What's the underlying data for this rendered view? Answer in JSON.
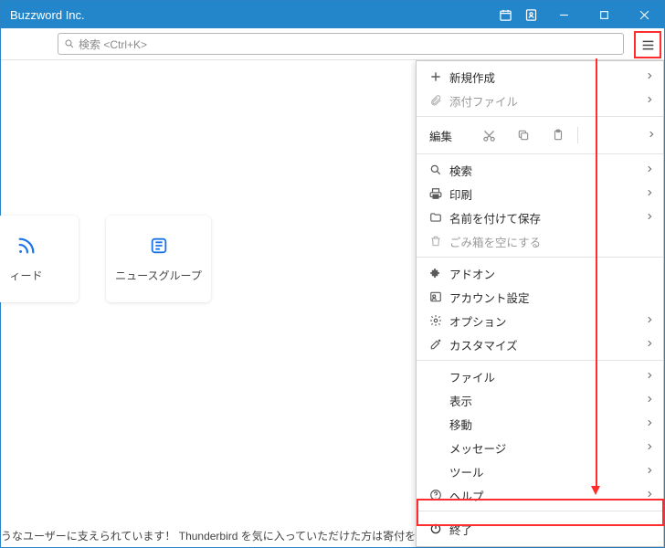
{
  "titlebar": {
    "title": "Buzzword Inc."
  },
  "search": {
    "placeholder": "検索 <Ctrl+K>"
  },
  "cards": {
    "feed": {
      "label": "ィード"
    },
    "newsgroup": {
      "label": "ニュースグループ"
    }
  },
  "menu": {
    "new_": "新規作成",
    "attach": "添付ファイル",
    "edit": "編集",
    "search": "検索",
    "print": "印刷",
    "saveas": "名前を付けて保存",
    "empty_trash": "ごみ箱を空にする",
    "addons": "アドオン",
    "account_settings": "アカウント設定",
    "options": "オプション",
    "customize": "カスタマイズ",
    "file": "ファイル",
    "view": "表示",
    "go": "移動",
    "message": "メッセージ",
    "tools": "ツール",
    "help": "ヘルプ",
    "exit": "終了"
  },
  "footer": "うなユーザーに支えられています！ Thunderbird を気に入っていただけた方は寄付をご検"
}
